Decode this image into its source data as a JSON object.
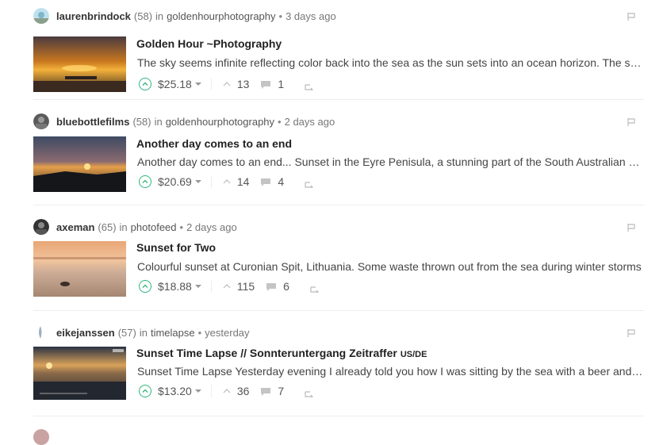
{
  "posts": [
    {
      "author": "laurenbrindock",
      "rep": "(58)",
      "in": "in",
      "category": "goldenhourphotography",
      "time": "3 days ago",
      "title": "Golden Hour ~Photography",
      "tag": "",
      "excerpt": "The sky seems infinite reflecting color back into the sea as the sun sets into an ocean horizon. The sky seems",
      "payout": "$25.18",
      "votes": "13",
      "comments": "1"
    },
    {
      "author": "bluebottlefilms",
      "rep": "(58)",
      "in": "in",
      "category": "goldenhourphotography",
      "time": "2 days ago",
      "title": "Another day comes to an end",
      "tag": "",
      "excerpt": "Another day comes to an end... Sunset in the Eyre Penisula, a stunning part of the South Australian coast line",
      "payout": "$20.69",
      "votes": "14",
      "comments": "4"
    },
    {
      "author": "axeman",
      "rep": "(65)",
      "in": "in",
      "category": "photofeed",
      "time": "2 days ago",
      "title": "Sunset for Two",
      "tag": "",
      "excerpt": "Colourful sunset at Curonian Spit, Lithuania. Some waste thrown out from the sea during winter storms",
      "payout": "$18.88",
      "votes": "115",
      "comments": "6"
    },
    {
      "author": "eikejanssen",
      "rep": "(57)",
      "in": "in",
      "category": "timelapse",
      "time": "yesterday",
      "title": "Sunset Time Lapse // Sonnteruntergang Zeitraffer",
      "tag": "US/DE",
      "excerpt": "Sunset Time Lapse Yesterday evening I already told you how I was sitting by the sea with a beer and watching",
      "payout": "$13.20",
      "votes": "36",
      "comments": "7"
    }
  ],
  "icons": {
    "upvote": "upvote-icon",
    "caret": "caret-down-icon",
    "votes": "votes-icon",
    "comments": "comments-icon",
    "reblog": "reblog-icon",
    "flag": "flag-icon"
  },
  "colors": {
    "accent": "#2db67c",
    "text": "#333333",
    "muted": "#777777"
  }
}
